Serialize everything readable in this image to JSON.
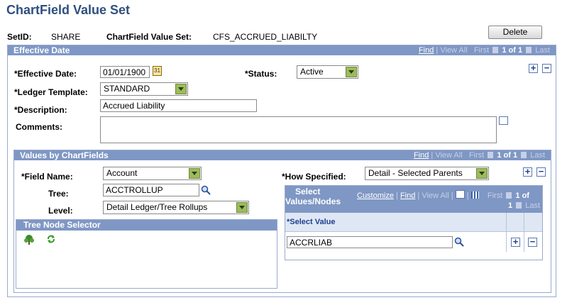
{
  "page": {
    "title": "ChartField Value Set"
  },
  "top": {
    "setid_label": "SetID:",
    "setid_value": "SHARE",
    "cfvs_label": "ChartField Value Set:",
    "cfvs_value": "CFS_ACCRUED_LIABILTY",
    "delete_label": "Delete"
  },
  "effective": {
    "header": "Effective Date",
    "nav": {
      "find": "Find",
      "view_all": "View All",
      "first": "First",
      "count": "1 of 1",
      "last": "Last"
    },
    "eff_date_label": "*Effective Date:",
    "eff_date_value": "01/01/1900",
    "status_label": "*Status:",
    "status_value": "Active",
    "ledger_label": "*Ledger Template:",
    "ledger_value": "STANDARD",
    "desc_label": "*Description:",
    "desc_value": "Accrued Liability",
    "comments_label": "Comments:"
  },
  "values": {
    "header": "Values by ChartFields",
    "nav": {
      "find": "Find",
      "view_all": "View All",
      "first": "First",
      "count": "1 of 1",
      "last": "Last"
    },
    "field_label": "*Field Name:",
    "field_value": "Account",
    "how_label": "*How Specified:",
    "how_value": "Detail - Selected Parents",
    "tree_label": "Tree:",
    "tree_value": "ACCTROLLUP",
    "level_label": "Level:",
    "level_value": "Detail Ledger/Tree Rollups"
  },
  "tree_node": {
    "header": "Tree Node Selector"
  },
  "select_grid": {
    "title_line1": "Select",
    "title_line2": "Values/Nodes",
    "customize": "Customize",
    "find": "Find",
    "view_all": "View All",
    "first": "First",
    "count_a": "1 of",
    "count_b": "1",
    "last": "Last",
    "col_header": "*Select Value",
    "row_value": "ACCRLIAB"
  },
  "colors": {
    "header_bg": "#7f97c4",
    "title": "#2f4f7f",
    "dropdown": "#9dbb5d"
  }
}
